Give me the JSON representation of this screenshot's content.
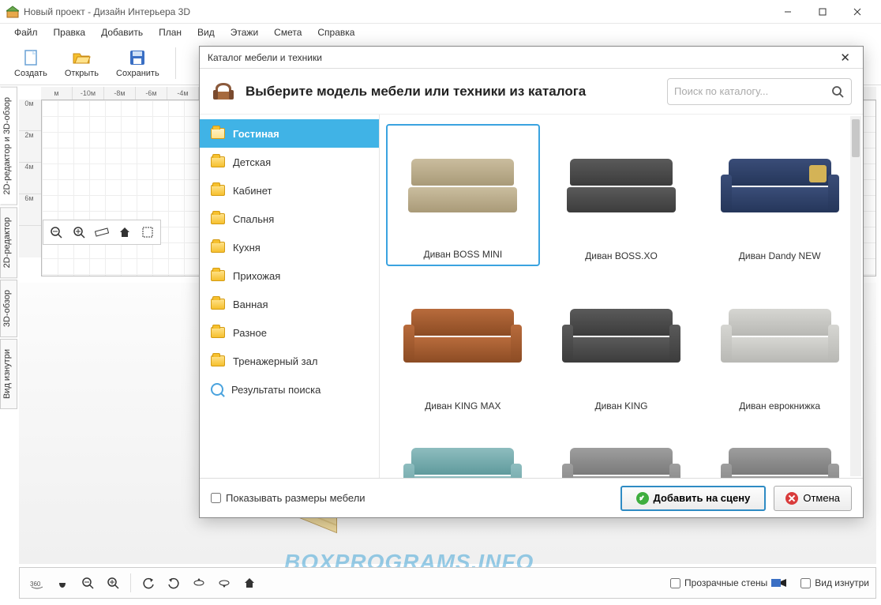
{
  "window": {
    "title": "Новый проект - Дизайн Интерьера 3D"
  },
  "menu": [
    "Файл",
    "Правка",
    "Добавить",
    "План",
    "Вид",
    "Этажи",
    "Смета",
    "Справка"
  ],
  "toolbar": {
    "create": "Создать",
    "open": "Открыть",
    "save": "Сохранить"
  },
  "side_tabs": [
    "2D-редактор и 3D-обзор",
    "2D-редактор",
    "3D-обзор",
    "Вид изнутри"
  ],
  "ruler_h": [
    "м",
    "-10м",
    "-8м",
    "-6м",
    "-4м"
  ],
  "ruler_v": [
    "0м",
    "2м",
    "4м",
    "6м"
  ],
  "bottom": {
    "transparent_walls": "Прозрачные стены",
    "inside_view": "Вид изнутри"
  },
  "watermark": "BOXPROGRAMS.INFO",
  "modal": {
    "title": "Каталог мебели и техники",
    "header_text": "Выберите модель мебели или техники из каталога",
    "search_placeholder": "Поиск по каталогу...",
    "categories": [
      "Гостиная",
      "Детская",
      "Кабинет",
      "Спальня",
      "Кухня",
      "Прихожая",
      "Ванная",
      "Разное",
      "Тренажерный зал",
      "Результаты поиска"
    ],
    "items": [
      {
        "name": "Диван BOSS MINI",
        "color": "c-tan",
        "arms": false,
        "selected": true
      },
      {
        "name": "Диван BOSS.XO",
        "color": "c-darkgrey",
        "arms": false
      },
      {
        "name": "Диван Dandy NEW",
        "color": "c-navy",
        "arms": true,
        "pillow": "#d4b356"
      },
      {
        "name": "Диван KING MAX",
        "color": "c-brown",
        "arms": true
      },
      {
        "name": "Диван KING",
        "color": "c-darkgrey",
        "arms": true
      },
      {
        "name": "Диван еврокнижка",
        "color": "c-lt",
        "arms": true
      },
      {
        "name": "",
        "color": "c-teal",
        "arms": true,
        "partial": true
      },
      {
        "name": "",
        "color": "c-grey",
        "arms": true,
        "partial": true
      },
      {
        "name": "",
        "color": "c-grey",
        "arms": true,
        "partial": true
      }
    ],
    "show_sizes": "Показывать размеры мебели",
    "add_btn": "Добавить на сцену",
    "cancel_btn": "Отмена"
  }
}
